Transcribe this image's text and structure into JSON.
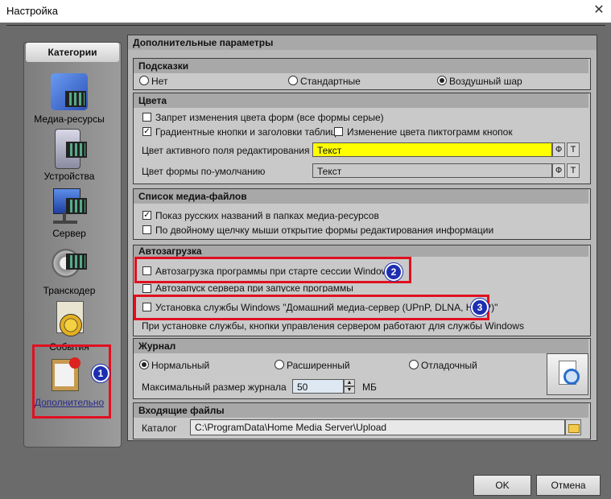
{
  "window": {
    "title": "Настройка",
    "close_glyph": "✕"
  },
  "sidebar": {
    "header": "Категории",
    "items": [
      {
        "label": "Медиа-ресурсы",
        "icon": "media-resources-icon"
      },
      {
        "label": "Устройства",
        "icon": "devices-icon"
      },
      {
        "label": "Сервер",
        "icon": "server-icon"
      },
      {
        "label": "Транскодер",
        "icon": "transcoder-icon"
      },
      {
        "label": "События",
        "icon": "events-icon"
      },
      {
        "label": "Дополнительно",
        "icon": "advanced-icon",
        "selected": true
      }
    ]
  },
  "main": {
    "header": "Дополнительные параметры",
    "hints": {
      "title": "Подсказки",
      "options": [
        {
          "label": "Нет",
          "selected": false
        },
        {
          "label": "Стандартные",
          "selected": false
        },
        {
          "label": "Воздушный шар",
          "selected": true
        }
      ]
    },
    "colors": {
      "title": "Цвета",
      "cb_form_colors": {
        "label": "Запрет изменения цвета форм (все формы серые)",
        "checked": false
      },
      "cb_gradient": {
        "label": "Градиентные кнопки и заголовки таблиц",
        "checked": true
      },
      "cb_icon_color": {
        "label": "Изменение цвета пиктограмм кнопок",
        "checked": false
      },
      "active_field": {
        "label": "Цвет активного поля редактирования",
        "value": "Текст",
        "bg": "#ffff00",
        "btn_f": "Ф",
        "btn_t": "Т"
      },
      "default_form": {
        "label": "Цвет формы по-умолчанию",
        "value": "Текст",
        "bg": "#c9c9c9",
        "btn_f": "Ф",
        "btn_t": "Т"
      }
    },
    "media_list": {
      "title": "Список медиа-файлов",
      "cb_russian": {
        "label": "Показ русских названий в папках медиа-ресурсов",
        "checked": true
      },
      "cb_doubleclick": {
        "label": "По двойному щелчку мыши открытие формы редактирования информации",
        "checked": false
      }
    },
    "autostart": {
      "title": "Автозагрузка",
      "cb_autoload": {
        "label": "Автозагрузка программы при старте сессии Windows",
        "checked": false
      },
      "cb_server_start": {
        "label": "Автозапуск сервера при запуске программы",
        "checked": false
      },
      "cb_service": {
        "label": "Установка службы Windows \"Домашний медиа-сервер (UPnP, DLNA, HTTP)\"",
        "checked": false
      },
      "note": "При установке службы, кнопки управления сервером работают для службы Windows"
    },
    "journal": {
      "title": "Журнал",
      "options": [
        {
          "label": "Нормальный",
          "selected": true
        },
        {
          "label": "Расширенный",
          "selected": false
        },
        {
          "label": "Отладочный",
          "selected": false
        }
      ],
      "size_label": "Максимальный размер  журнала",
      "size_value": "50",
      "size_unit": "МБ"
    },
    "incoming": {
      "title": "Входящие файлы",
      "catalog_label": "Каталог",
      "catalog_value": "C:\\ProgramData\\Home Media Server\\Upload"
    }
  },
  "annotations": {
    "badge1": "1",
    "badge2": "2",
    "badge3": "3",
    "highlight_color": "#e01020"
  },
  "buttons": {
    "ok": "OK",
    "cancel": "Отмена"
  }
}
